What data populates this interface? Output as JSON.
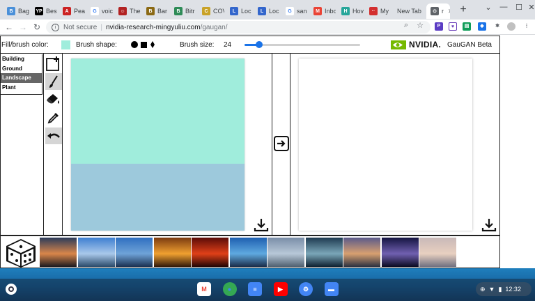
{
  "browser": {
    "tabs": [
      {
        "label": "Bag",
        "fav_color": "#4a90d9",
        "fav_glyph": "B"
      },
      {
        "label": "Best",
        "fav_color": "#000000",
        "fav_glyph": "YP"
      },
      {
        "label": "Peal",
        "fav_color": "#cc2222",
        "fav_glyph": "A"
      },
      {
        "label": "voic",
        "fav_color": "#ffffff",
        "fav_glyph": "G"
      },
      {
        "label": "The",
        "fav_color": "#b22222",
        "fav_glyph": "☺"
      },
      {
        "label": "Bar",
        "fav_color": "#8b6914",
        "fav_glyph": "B"
      },
      {
        "label": "Bitr",
        "fav_color": "#2e8b57",
        "fav_glyph": "B"
      },
      {
        "label": "COV",
        "fav_color": "#c9a227",
        "fav_glyph": "C"
      },
      {
        "label": "Loc",
        "fav_color": "#3366cc",
        "fav_glyph": "L"
      },
      {
        "label": "Loc",
        "fav_color": "#3366cc",
        "fav_glyph": "L"
      },
      {
        "label": "san",
        "fav_color": "#ffffff",
        "fav_glyph": "G"
      },
      {
        "label": "Inbo",
        "fav_color": "#ea4335",
        "fav_glyph": "M"
      },
      {
        "label": "Hov",
        "fav_color": "#26a69a",
        "fav_glyph": "H"
      },
      {
        "label": "My",
        "fav_color": "#d32f2f",
        "fav_glyph": "··"
      },
      {
        "label": "New Tab",
        "fav_color": "#dee1e6",
        "fav_glyph": ""
      },
      {
        "label": "r",
        "fav_color": "#5f6368",
        "fav_glyph": "⊙"
      }
    ],
    "new_tab_glyph": "+",
    "window": {
      "minimize": "⌄",
      "restore": "—",
      "maximize": "☐",
      "close": "✕"
    },
    "address": {
      "security": "Not secure",
      "host": "nvidia-research-mingyuliu.com",
      "path": "/gaugan/"
    }
  },
  "app": {
    "fill_label": "Fill/brush color:",
    "fill_color": "#a0eddc",
    "shape_label": "Brush shape:",
    "size_label": "Brush size:",
    "size_value": "24",
    "brand": "NVIDIA.",
    "app_title": "GauGAN Beta",
    "labels": [
      "Building",
      "Ground",
      "Landscape",
      "Plant"
    ],
    "selected_label": "Landscape",
    "canvas_colors": {
      "sky": "#a0eddc",
      "ground": "#9dc9dc"
    }
  },
  "thumbnails": [
    {
      "top": "#2b3b5a",
      "mid": "#d9864a",
      "bot": "#1a1a20"
    },
    {
      "top": "#3d7fd1",
      "mid": "#a9c8ea",
      "bot": "#2a4a6a"
    },
    {
      "top": "#2f6fc0",
      "mid": "#6fa3d8",
      "bot": "#1a3050"
    },
    {
      "top": "#7a3a10",
      "mid": "#f0a030",
      "bot": "#301808"
    },
    {
      "top": "#5a0c08",
      "mid": "#e04018",
      "bot": "#200404"
    },
    {
      "top": "#1e5fb0",
      "mid": "#5fa9e0",
      "bot": "#1a2c48"
    },
    {
      "top": "#7a8ea8",
      "mid": "#b8c8d8",
      "bot": "#506070"
    },
    {
      "top": "#1e3a50",
      "mid": "#7aa6b8",
      "bot": "#0e2030"
    },
    {
      "top": "#5a5a8a",
      "mid": "#d8a070",
      "bot": "#2a3040"
    },
    {
      "top": "#141440",
      "mid": "#7060b0",
      "bot": "#0a0a20"
    },
    {
      "top": "#c8b8b8",
      "mid": "#e8d0c0",
      "bot": "#707080"
    }
  ],
  "shelf": {
    "apps": [
      {
        "name": "gmail",
        "color": "#ffffff",
        "glyph": "M",
        "glyph_color": "#ea4335"
      },
      {
        "name": "chrome",
        "color": "#34a853",
        "glyph": "●",
        "glyph_color": "#4285f4"
      },
      {
        "name": "docs",
        "color": "#4285f4",
        "glyph": "≡",
        "glyph_color": "#ffffff"
      },
      {
        "name": "youtube",
        "color": "#ff0000",
        "glyph": "▶",
        "glyph_color": "#ffffff"
      },
      {
        "name": "settings",
        "color": "#4285f4",
        "glyph": "⚙",
        "glyph_color": "#ffffff"
      },
      {
        "name": "files",
        "color": "#4285f4",
        "glyph": "▬",
        "glyph_color": "#ffffff"
      }
    ],
    "time": "12:32"
  }
}
